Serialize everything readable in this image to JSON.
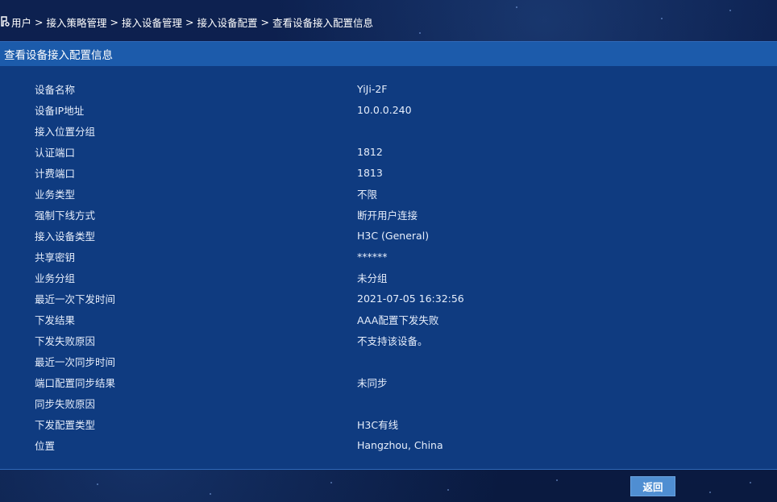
{
  "breadcrumb": {
    "items": [
      "用户",
      "接入策略管理",
      "接入设备管理",
      "接入设备配置",
      "查看设备接入配置信息"
    ],
    "separator": ">"
  },
  "panel": {
    "title": "查看设备接入配置信息"
  },
  "details": [
    {
      "label": "设备名称",
      "value": "YiJi-2F"
    },
    {
      "label": "设备IP地址",
      "value": "10.0.0.240"
    },
    {
      "label": "接入位置分组",
      "value": ""
    },
    {
      "label": "认证端口",
      "value": "1812"
    },
    {
      "label": "计费端口",
      "value": "1813"
    },
    {
      "label": "业务类型",
      "value": "不限"
    },
    {
      "label": "强制下线方式",
      "value": "断开用户连接"
    },
    {
      "label": "接入设备类型",
      "value": "H3C (General)"
    },
    {
      "label": "共享密钥",
      "value": "******"
    },
    {
      "label": "业务分组",
      "value": "未分组"
    },
    {
      "label": "最近一次下发时间",
      "value": "2021-07-05 16:32:56"
    },
    {
      "label": "下发结果",
      "value": "AAA配置下发失败"
    },
    {
      "label": "下发失败原因",
      "value": "不支持该设备。"
    },
    {
      "label": "最近一次同步时间",
      "value": ""
    },
    {
      "label": "端口配置同步结果",
      "value": "未同步"
    },
    {
      "label": "同步失败原因",
      "value": ""
    },
    {
      "label": "下发配置类型",
      "value": "H3C有线"
    },
    {
      "label": "位置",
      "value": "Hangzhou, China"
    }
  ],
  "footer": {
    "back_label": "返回"
  },
  "colors": {
    "background": "#0b1b3f",
    "panel": "#0f3b80",
    "panel_header": "#1c5bab",
    "button": "#4f8ed2",
    "text": "#ffffff"
  },
  "icons": {
    "breadcrumb": "user-nav-icon"
  }
}
